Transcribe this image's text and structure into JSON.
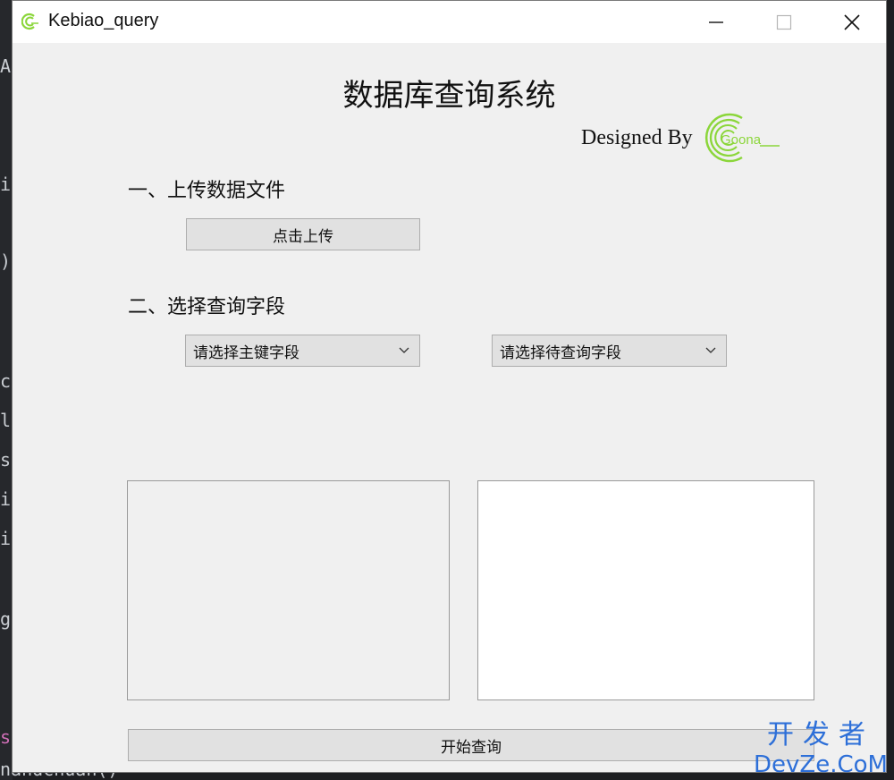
{
  "window": {
    "title": "Kebiao_query"
  },
  "header": {
    "title": "数据库查询系统",
    "designed_by": "Designed By",
    "logo_text": "Goona"
  },
  "section1": {
    "heading": "一、上传数据文件",
    "upload_button": "点击上传"
  },
  "section2": {
    "heading": "二、选择查询字段",
    "primary_key_select": "请选择主键字段",
    "query_field_select": "请选择待查询字段"
  },
  "footer": {
    "query_button": "开始查询"
  },
  "background": {
    "left_chars": [
      "A",
      "i",
      ")",
      "c",
      "l",
      "s",
      "i",
      "i",
      "g",
      "s"
    ],
    "bottom_line": "nandchuan()"
  },
  "watermark": {
    "line1": "开发者",
    "line2": "DevZe.CoM"
  },
  "colors": {
    "accent": "#8bd63a",
    "watermark": "#2d6fd8",
    "window_bg": "#f0f0f0"
  }
}
